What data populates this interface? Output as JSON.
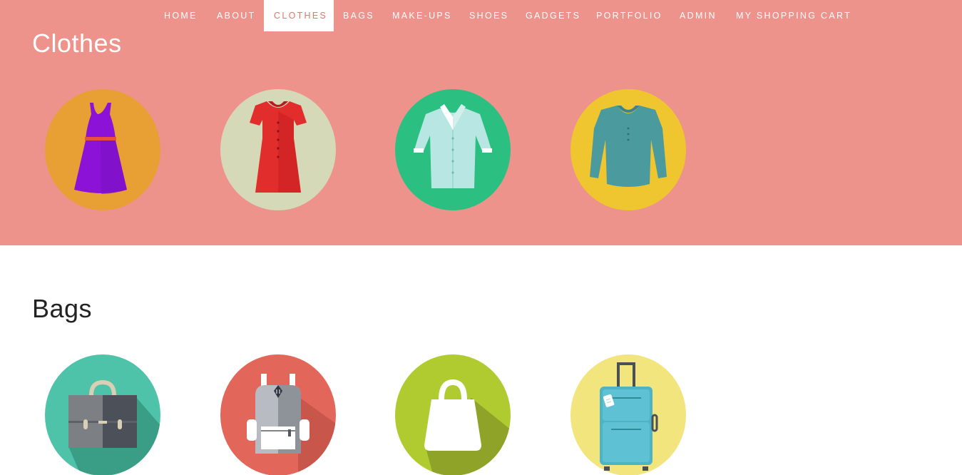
{
  "nav": {
    "items": [
      {
        "label": "HOME",
        "active": false
      },
      {
        "label": "ABOUT",
        "active": false
      },
      {
        "label": "CLOTHES",
        "active": true
      },
      {
        "label": "BAGS",
        "active": false
      },
      {
        "label": "MAKE-UPS",
        "active": false
      },
      {
        "label": "SHOES",
        "active": false
      },
      {
        "label": "GADGETS",
        "active": false
      },
      {
        "label": "PORTFOLIO",
        "active": false
      },
      {
        "label": "ADMIN",
        "active": false
      },
      {
        "label": "MY SHOPPING CART",
        "active": false
      }
    ]
  },
  "clothes": {
    "title": "Clothes",
    "background": "#ee938c",
    "items": [
      {
        "icon": "purple-dress-icon",
        "circle_color": "#e89f34"
      },
      {
        "icon": "red-dress-icon",
        "circle_color": "#d6d9b8"
      },
      {
        "icon": "white-shirt-icon",
        "circle_color": "#2bbf82"
      },
      {
        "icon": "teal-blouse-icon",
        "circle_color": "#efc530"
      }
    ]
  },
  "bags": {
    "title": "Bags",
    "items": [
      {
        "icon": "briefcase-icon",
        "circle_color": "#4fc3a9"
      },
      {
        "icon": "backpack-icon",
        "circle_color": "#e2675a"
      },
      {
        "icon": "shopping-bag-icon",
        "circle_color": "#b0cb30"
      },
      {
        "icon": "suitcase-icon",
        "circle_color": "#f2e57e"
      }
    ]
  }
}
